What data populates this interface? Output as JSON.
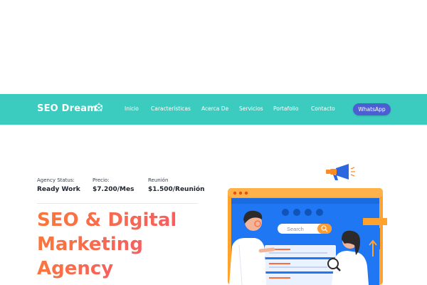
{
  "brand": {
    "name": "SEO Dream"
  },
  "nav": {
    "items": [
      "Inicio",
      "Características",
      "Acerca De",
      "Servicios",
      "Portafolio",
      "Contacto"
    ],
    "cta": "WhatsApp"
  },
  "stats": [
    {
      "label": "Agency Status:",
      "value": "Ready Work"
    },
    {
      "label": "Precio:",
      "value": "$7.200/Mes"
    },
    {
      "label": "Reunión",
      "value": "$1.500/Reunión"
    }
  ],
  "hero": {
    "lines": [
      "SEO & Digital",
      "Marketing",
      "Agency"
    ]
  },
  "illustration": {
    "search_placeholder": "Search"
  },
  "colors": {
    "nav_bg": "#3ccbbf",
    "cta_bg": "#4b5fd3",
    "headline_start": "#f9773c",
    "headline_end": "#f65f5f"
  }
}
